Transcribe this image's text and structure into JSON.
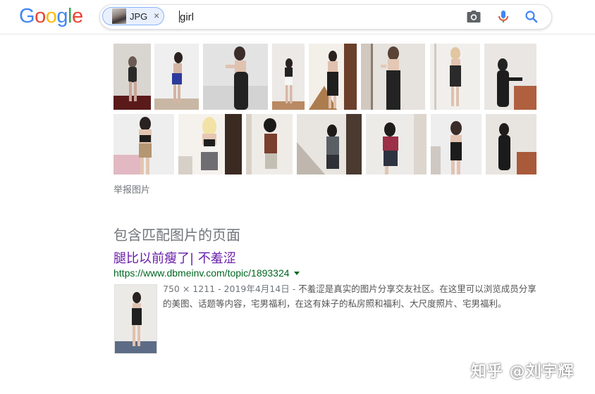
{
  "header": {
    "logo": [
      "G",
      "o",
      "o",
      "g",
      "l",
      "e"
    ],
    "logo_colors": [
      "#4285f4",
      "#ea4335",
      "#fbbc05",
      "#4285f4",
      "#34a853",
      "#ea4335"
    ],
    "chip_label": "JPG",
    "chip_close": "×",
    "query": "girl"
  },
  "icons": {
    "camera": "camera-icon",
    "mic": "microphone-icon",
    "search": "search-icon"
  },
  "grid": {
    "report_label": "举报图片"
  },
  "results": {
    "section_title": "包含匹配图片的页面",
    "items": [
      {
        "title": "腿比以前瘦了| 不羞涩",
        "url": "https://www.dbmeinv.com/topic/1893324",
        "meta": "750 × 1211 - 2019年4月14日 - ",
        "snippet": "不羞涩是真实的图片分享交友社区。在这里可以浏览成员分享的美图、话题等内容，宅男福利，在这有妹子的私房照和福利、大尺度照片、宅男福利。"
      }
    ]
  },
  "watermark": "知乎 @刘宇辉",
  "colors": {
    "link_visited": "#681da8",
    "url_green": "#006621",
    "chip_bg": "#e8f0fe"
  }
}
